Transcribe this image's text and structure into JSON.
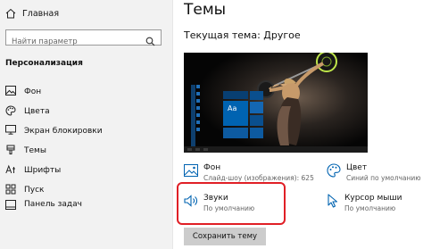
{
  "sidebar": {
    "home_label": "Главная",
    "search_placeholder": "Найти параметр",
    "section_title": "Персонализация",
    "items": [
      {
        "label": "Фон",
        "icon": "picture-icon"
      },
      {
        "label": "Цвета",
        "icon": "palette-icon"
      },
      {
        "label": "Экран блокировки",
        "icon": "monitor-icon"
      },
      {
        "label": "Темы",
        "icon": "brush-icon"
      },
      {
        "label": "Шрифты",
        "icon": "font-icon"
      },
      {
        "label": "Пуск",
        "icon": "start-icon"
      },
      {
        "label": "Панель задач",
        "icon": "taskbar-icon"
      }
    ]
  },
  "main": {
    "title": "Темы",
    "current_theme": "Текущая тема: Другое",
    "tile_label": "Aa",
    "accent_color": "#0063b1",
    "options": {
      "background": {
        "title": "Фон",
        "subtitle": "Слайд-шоу (изображения): 625"
      },
      "color": {
        "title": "Цвет",
        "subtitle": "Синий по умолчанию"
      },
      "sounds": {
        "title": "Звуки",
        "subtitle": "По умолчанию"
      },
      "cursor": {
        "title": "Курсор мыши",
        "subtitle": "По умолчанию"
      }
    },
    "save_button": "Сохранить тему"
  }
}
